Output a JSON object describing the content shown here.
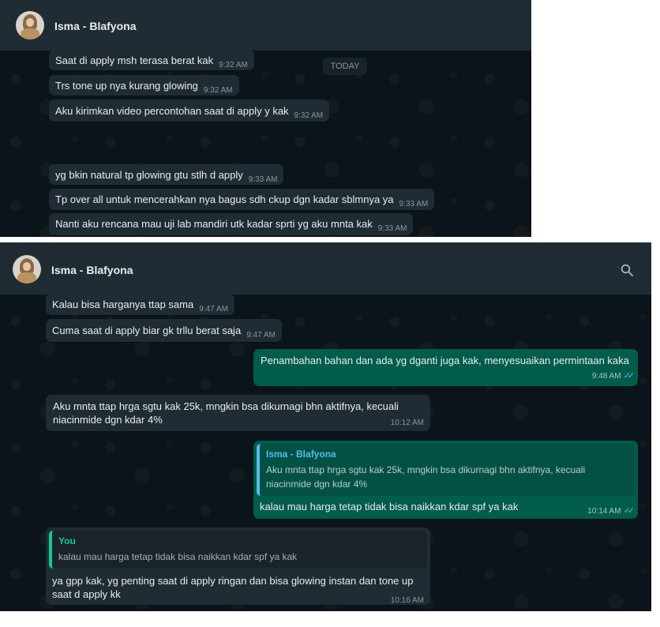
{
  "panel1": {
    "contact_name": "Isma - Blafyona",
    "date_chip": "TODAY",
    "messages": [
      {
        "text": "Saat di apply msh terasa berat kak",
        "time": "9:32 AM"
      },
      {
        "text": "Trs tone up nya kurang glowing",
        "time": "9:32 AM"
      },
      {
        "text": "Aku kirimkan video percontohan saat di apply y kak",
        "time": "9:32 AM"
      },
      {
        "text": "yg bkin natural tp glowing gtu stlh d apply",
        "time": "9:33 AM"
      },
      {
        "text": "Tp over all untuk mencerahkan nya bagus sdh ckup dgn kadar sblmnya ya",
        "time": "9:33 AM"
      },
      {
        "text": "Nanti aku rencana mau uji lab mandiri utk kadar sprti yg aku mnta kak",
        "time": "9:33 AM"
      }
    ]
  },
  "panel2": {
    "contact_name": "Isma - Blafyona",
    "messages": [
      {
        "text": "Kalau bisa harganya ttap sama",
        "time": "9:47 AM"
      },
      {
        "text": "Cuma saat di apply biar gk trllu berat saja",
        "time": "9:47 AM"
      },
      {
        "text": "Penambahan bahan dan ada yg dganti juga kak, menyesuaikan permintaan kaka",
        "time": "9:48 AM"
      },
      {
        "text": "Aku mnta ttap hrga sgtu kak 25k, mngkin bsa dikurnagi bhn aktifnya, kecuali niacinmide dgn kdar 4%",
        "time": "10:12 AM"
      },
      {
        "quote_name": "Isma - Blafyona",
        "quote_text": "Aku mnta ttap hrga sgtu kak 25k, mngkin bsa dikurnagi bhn aktifnya, kecuali niacinmide dgn kdar 4%",
        "text": "kalau mau harga tetap tidak bisa naikkan kdar spf ya kak",
        "time": "10:14 AM"
      },
      {
        "quote_name": "You",
        "quote_text": "kalau mau harga tetap tidak bisa naikkan kdar spf ya kak",
        "text": "ya gpp kak, yg penting saat di apply ringan dan bisa glowing instan dan tone up saat d apply kk",
        "time": "10:16 AM"
      }
    ]
  },
  "icons": {
    "search": "search-icon",
    "read_receipt": "double-check-icon",
    "avatar": "profile-photo"
  },
  "colors": {
    "background": "#0b141a",
    "header": "#202c33",
    "incoming_bubble": "#202c33",
    "outgoing_bubble": "#005c4b",
    "read_tick": "#53bdeb",
    "quote_accent_contact": "#53bdeb",
    "quote_accent_you": "#06cf9c"
  }
}
